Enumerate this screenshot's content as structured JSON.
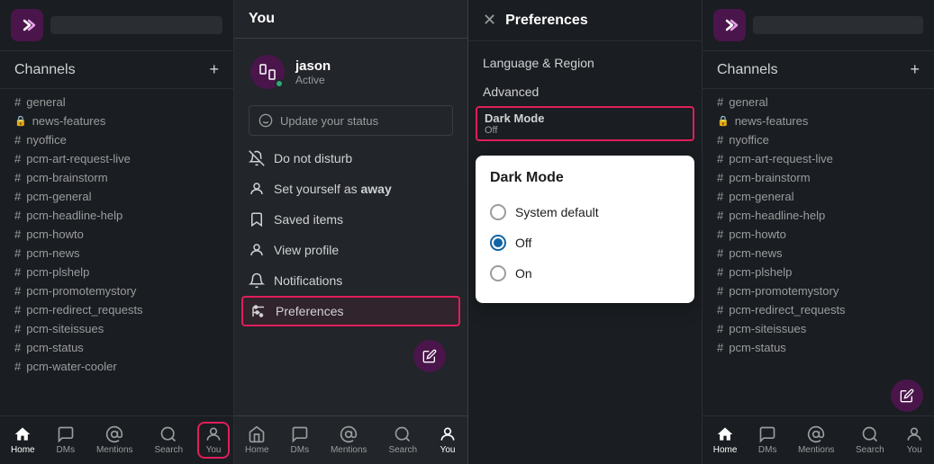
{
  "app": {
    "logo_icon": "Z",
    "brand_color": "#4a154b"
  },
  "left_sidebar": {
    "channels_label": "Channels",
    "add_button_label": "+",
    "channels": [
      {
        "icon": "#",
        "name": "general"
      },
      {
        "icon": "🔒",
        "name": "news-features",
        "locked": true
      },
      {
        "icon": "#",
        "name": "nyoffice"
      },
      {
        "icon": "#",
        "name": "pcm-art-request-live"
      },
      {
        "icon": "#",
        "name": "pcm-brainstorm"
      },
      {
        "icon": "#",
        "name": "pcm-general"
      },
      {
        "icon": "#",
        "name": "pcm-headline-help"
      },
      {
        "icon": "#",
        "name": "pcm-howto"
      },
      {
        "icon": "#",
        "name": "pcm-news"
      },
      {
        "icon": "#",
        "name": "pcm-plshelp"
      },
      {
        "icon": "#",
        "name": "pcm-promotemystory"
      },
      {
        "icon": "#",
        "name": "pcm-redirect_requests"
      },
      {
        "icon": "#",
        "name": "pcm-siteissues"
      },
      {
        "icon": "#",
        "name": "pcm-status"
      },
      {
        "icon": "#",
        "name": "pcm-water-cooler"
      }
    ],
    "nav": [
      {
        "icon": "home",
        "label": "Home",
        "active": true
      },
      {
        "icon": "dms",
        "label": "DMs",
        "active": false
      },
      {
        "icon": "mentions",
        "label": "Mentions",
        "active": false
      },
      {
        "icon": "search",
        "label": "Search",
        "active": false
      },
      {
        "icon": "you",
        "label": "You",
        "active": false,
        "highlighted": true
      }
    ]
  },
  "you_panel": {
    "title": "You",
    "user": {
      "name": "jason",
      "status": "Active"
    },
    "status_placeholder": "Update your status",
    "menu_items": [
      {
        "icon": "bell-off",
        "label": "Do not disturb"
      },
      {
        "icon": "person-away",
        "label": "Set yourself as ",
        "label_bold": "away"
      },
      {
        "icon": "bookmark",
        "label": "Saved items"
      },
      {
        "icon": "person",
        "label": "View profile"
      },
      {
        "icon": "bell",
        "label": "Notifications"
      },
      {
        "icon": "sliders",
        "label": "Preferences",
        "highlighted": true
      }
    ],
    "nav": [
      {
        "icon": "home",
        "label": "Home",
        "active": false
      },
      {
        "icon": "dms",
        "label": "DMs",
        "active": false
      },
      {
        "icon": "mentions",
        "label": "Mentions",
        "active": false
      },
      {
        "icon": "search",
        "label": "Search",
        "active": false
      },
      {
        "icon": "you",
        "label": "You",
        "active": true
      }
    ]
  },
  "preferences_panel": {
    "title": "Preferences",
    "close_label": "×",
    "menu_items": [
      {
        "label": "Language & Region"
      },
      {
        "label": "Advanced"
      },
      {
        "label": "Dark Mode",
        "sublabel": "Off",
        "highlighted": true
      }
    ],
    "dark_mode_popup": {
      "title": "Dark Mode",
      "options": [
        {
          "label": "System default",
          "selected": false
        },
        {
          "label": "Off",
          "selected": true
        },
        {
          "label": "On",
          "selected": false
        }
      ]
    }
  },
  "right_sidebar": {
    "channels_label": "Channels",
    "add_button_label": "+",
    "channels": [
      {
        "icon": "#",
        "name": "general"
      },
      {
        "icon": "🔒",
        "name": "news-features",
        "locked": true
      },
      {
        "icon": "#",
        "name": "nyoffice"
      },
      {
        "icon": "#",
        "name": "pcm-art-request-live"
      },
      {
        "icon": "#",
        "name": "pcm-brainstorm"
      },
      {
        "icon": "#",
        "name": "pcm-general"
      },
      {
        "icon": "#",
        "name": "pcm-headline-help"
      },
      {
        "icon": "#",
        "name": "pcm-howto"
      },
      {
        "icon": "#",
        "name": "pcm-news"
      },
      {
        "icon": "#",
        "name": "pcm-plshelp"
      },
      {
        "icon": "#",
        "name": "pcm-promotemystory"
      },
      {
        "icon": "#",
        "name": "pcm-redirect_requests"
      },
      {
        "icon": "#",
        "name": "pcm-siteissues"
      },
      {
        "icon": "#",
        "name": "pcm-status"
      }
    ],
    "nav": [
      {
        "icon": "home",
        "label": "Home",
        "active": true
      },
      {
        "icon": "dms",
        "label": "DMs",
        "active": false
      },
      {
        "icon": "mentions",
        "label": "Mentions",
        "active": false
      },
      {
        "icon": "search",
        "label": "Search",
        "active": false
      },
      {
        "icon": "you",
        "label": "You",
        "active": false
      }
    ]
  }
}
